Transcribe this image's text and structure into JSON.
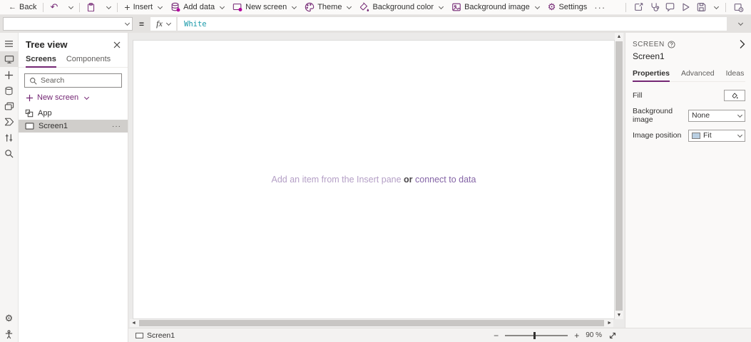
{
  "topbar": {
    "back": "Back",
    "insert": "Insert",
    "add_data": "Add data",
    "new_screen": "New screen",
    "theme": "Theme",
    "background_color": "Background color",
    "background_image": "Background image",
    "settings": "Settings",
    "overflow": "···"
  },
  "icons": {
    "back_arrow": "←",
    "undo": "↶",
    "settings_gear": "⚙",
    "up_arrow": "▲",
    "down_arrow": "▼",
    "left_arrow": "◄",
    "right_arrow": "►"
  },
  "formula_bar": {
    "property_value": "",
    "equals": "=",
    "fx": "fx",
    "formula": "White"
  },
  "tree_view": {
    "title": "Tree view",
    "tab_screens": "Screens",
    "tab_components": "Components",
    "search_placeholder": "Search",
    "new_screen": "New screen",
    "item_app": "App",
    "item_screen1": "Screen1",
    "ellipsis": "···"
  },
  "canvas": {
    "hint_text": "Add an item from the Insert pane ",
    "hint_or": "or",
    "hint_link": " connect to data"
  },
  "right_panel": {
    "header": "SCREEN",
    "screen_name": "Screen1",
    "tab_properties": "Properties",
    "tab_advanced": "Advanced",
    "tab_ideas": "Ideas",
    "fill_label": "Fill",
    "background_image_label": "Background image",
    "background_image_value": "None",
    "image_position_label": "Image position",
    "image_position_value": "Fit"
  },
  "bottom_bar": {
    "screen_tab": "Screen1",
    "zoom_out": "−",
    "zoom_in": "+",
    "zoom_value": "90 %"
  },
  "colors": {
    "accent_purple": "#742774",
    "formula_text_teal": "#1b9aaa",
    "selected_row_grey": "#d0cecb",
    "canvas_hint_purple": "#b49fc6"
  }
}
